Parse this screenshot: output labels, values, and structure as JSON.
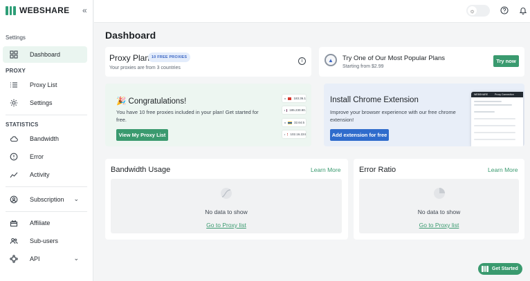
{
  "brand": {
    "name": "WEBSHARE",
    "color": "#2e9e77"
  },
  "sidebar": {
    "collapse_icon": "«",
    "section_settings": "Settings",
    "section_proxy": "PROXY",
    "section_statistics": "STATISTICS",
    "items": {
      "dashboard": "Dashboard",
      "proxy_list": "Proxy List",
      "settings": "Settings",
      "bandwidth": "Bandwidth",
      "error": "Error",
      "activity": "Activity",
      "subscription": "Subscription",
      "affiliate": "Affiliate",
      "sub_users": "Sub-users",
      "api": "API"
    }
  },
  "page": {
    "title": "Dashboard"
  },
  "proxy_plan": {
    "title": "Proxy Plan",
    "badge": "10 FREE PROXIES",
    "subtitle": "Your proxies are from 3 countries"
  },
  "popular_plans": {
    "title": "Try One of Our Most Popular Plans",
    "subtitle": "Starting from $2.99",
    "button": "Try now"
  },
  "congrats": {
    "title": "🎉 Congratulations!",
    "text": "You have 10 free proxies included in your plan! Get started for free.",
    "button": "View My Proxy List",
    "proxies": [
      "183.36.1",
      "185.230.90.",
      "32.64.5",
      "102.16.224"
    ]
  },
  "chrome_ext": {
    "title": "Install Chrome Extension",
    "text": "Improve your browser experience with our free chrome extension!",
    "button": "Add extension for free",
    "mock_header": "WEBSHARE",
    "mock_tab": "Proxy Connection"
  },
  "bandwidth": {
    "title": "Bandwidth Usage",
    "learn_more": "Learn More",
    "empty_text": "No data to show",
    "link": "Go to Proxy list"
  },
  "error_ratio": {
    "title": "Error Ratio",
    "learn_more": "Learn More",
    "empty_text": "No data to show",
    "link": "Go to Proxy list"
  },
  "get_started": "Get Started"
}
